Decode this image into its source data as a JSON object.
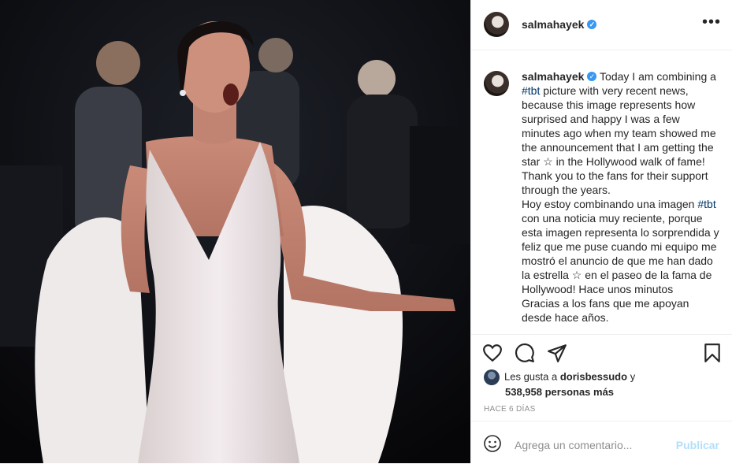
{
  "post": {
    "username": "salmahayek",
    "verified_icon": "verified-badge-icon",
    "more_icon": "more-options-icon"
  },
  "caption": {
    "username": "salmahayek",
    "paragraph1_before": "Today I am combining a ",
    "hashtag1": "#tbt",
    "paragraph1_after": " picture with very recent news, because this image represents how surprised and happy I was a few minutes ago when my team showed me the announcement that I am getting the star ☆ in the Hollywood walk of fame!",
    "paragraph2": "Thank you to the fans for their support through the years.",
    "paragraph3_before": "Hoy estoy combinando una imagen ",
    "hashtag2": "#tbt",
    "paragraph3_after": " con una noticia muy reciente, porque esta imagen representa lo sorprendida y feliz que me puse cuando mi equipo me mostró el anuncio de que me han dado la estrella ☆ en el paseo de la fama de Hollywood! Hace unos minutos",
    "paragraph4": "Gracias a los fans que me apoyan desde hace años."
  },
  "actions": {
    "like_icon": "heart-icon",
    "comment_icon": "comment-icon",
    "share_icon": "share-icon",
    "save_icon": "bookmark-icon"
  },
  "likes": {
    "prefix": "Les gusta a ",
    "user": "dorisbessudo",
    "middle": " y",
    "count": "538,958 personas más"
  },
  "timestamp": "HACE 6 DÍAS",
  "comment_box": {
    "placeholder": "Agrega un comentario...",
    "post_label": "Publicar",
    "emoji_icon": "emoji-icon"
  }
}
